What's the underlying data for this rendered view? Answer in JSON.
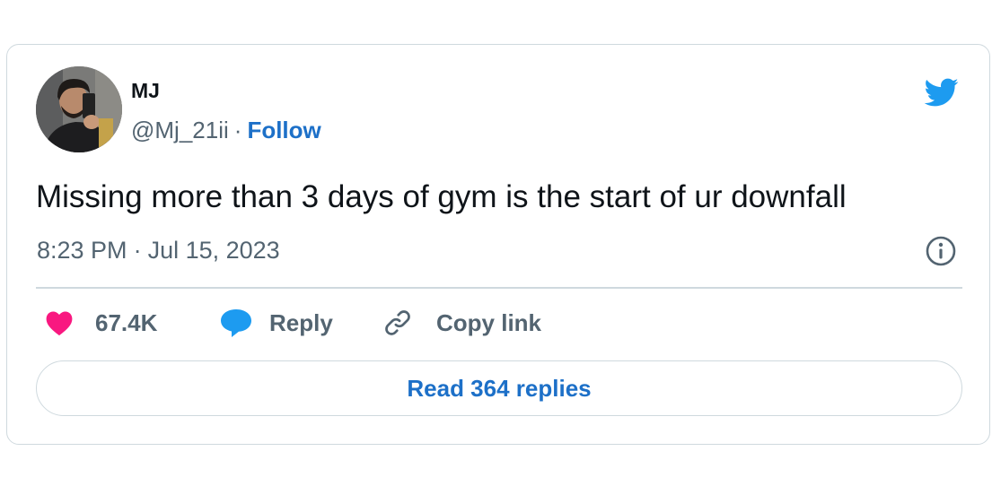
{
  "author": {
    "display_name": "MJ",
    "handle": "@Mj_21ii",
    "separator": "·",
    "follow_label": "Follow"
  },
  "tweet": {
    "text": "Missing more than 3 days of gym is the start of ur downfall",
    "time": "8:23 PM",
    "separator": "·",
    "date": "Jul 15, 2023"
  },
  "actions": {
    "likes": "67.4K",
    "reply_label": "Reply",
    "copy_label": "Copy link"
  },
  "read_replies_label": "Read 364 replies",
  "icons": {
    "brand": "twitter-bird-icon",
    "info": "info-icon",
    "like": "heart-icon",
    "reply": "speech-bubble-icon",
    "copy": "link-icon"
  },
  "colors": {
    "twitter_blue": "#1d9bf0",
    "link_blue": "#1d70c8",
    "heart_pink": "#f91880",
    "text_primary": "#0f1419",
    "text_secondary": "#536471",
    "border": "#cfd9de"
  }
}
